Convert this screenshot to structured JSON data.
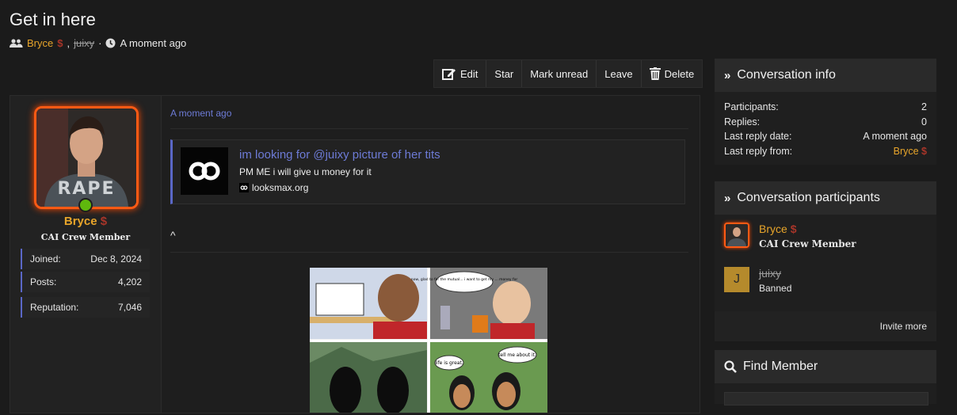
{
  "thread": {
    "title": "Get in here",
    "participants": [
      {
        "name": "Bryce"
      },
      {
        "name": "juixy"
      }
    ],
    "separator": ",",
    "dot": "·",
    "time": "A moment ago"
  },
  "toolbar": {
    "edit": "Edit",
    "star": "Star",
    "mark_unread": "Mark unread",
    "leave": "Leave",
    "delete": "Delete"
  },
  "post": {
    "author": "Bryce",
    "user_title": "CAI Crew Member",
    "stats": [
      {
        "label": "Joined:",
        "value": "Dec 8, 2024"
      },
      {
        "label": "Posts:",
        "value": "4,202"
      },
      {
        "label": "Reputation:",
        "value": "7,046"
      }
    ],
    "date": "A moment ago",
    "embed": {
      "title": "im looking for @juixy picture of her tits",
      "description": "PM ME i will give u money for it",
      "domain": "looksmax.org"
    },
    "text": "^",
    "comic": {
      "bubble1": "now, glad to for the mutual... i want to get my ... money for",
      "bubble2": "life is great.",
      "bubble3": "tell me about it."
    }
  },
  "info": {
    "title": "Conversation info",
    "rows": [
      {
        "label": "Participants:",
        "value": "2"
      },
      {
        "label": "Replies:",
        "value": "0"
      },
      {
        "label": "Last reply date:",
        "value": "A moment ago"
      },
      {
        "label": "Last reply from:",
        "value": "Bryce"
      }
    ]
  },
  "participants_box": {
    "title": "Conversation participants",
    "list": [
      {
        "name": "Bryce",
        "title": "CAI Crew Member"
      },
      {
        "name": "juixy",
        "title": "Banned",
        "initial": "J"
      }
    ],
    "invite": "Invite more"
  },
  "find": {
    "title": "Find Member"
  },
  "colors": {
    "accent": "#5a67c7",
    "gold": "#e8a52a",
    "avatar_ring": "#ff5a14",
    "online": "#5fb80d",
    "initial_bg": "#b58a2c"
  }
}
